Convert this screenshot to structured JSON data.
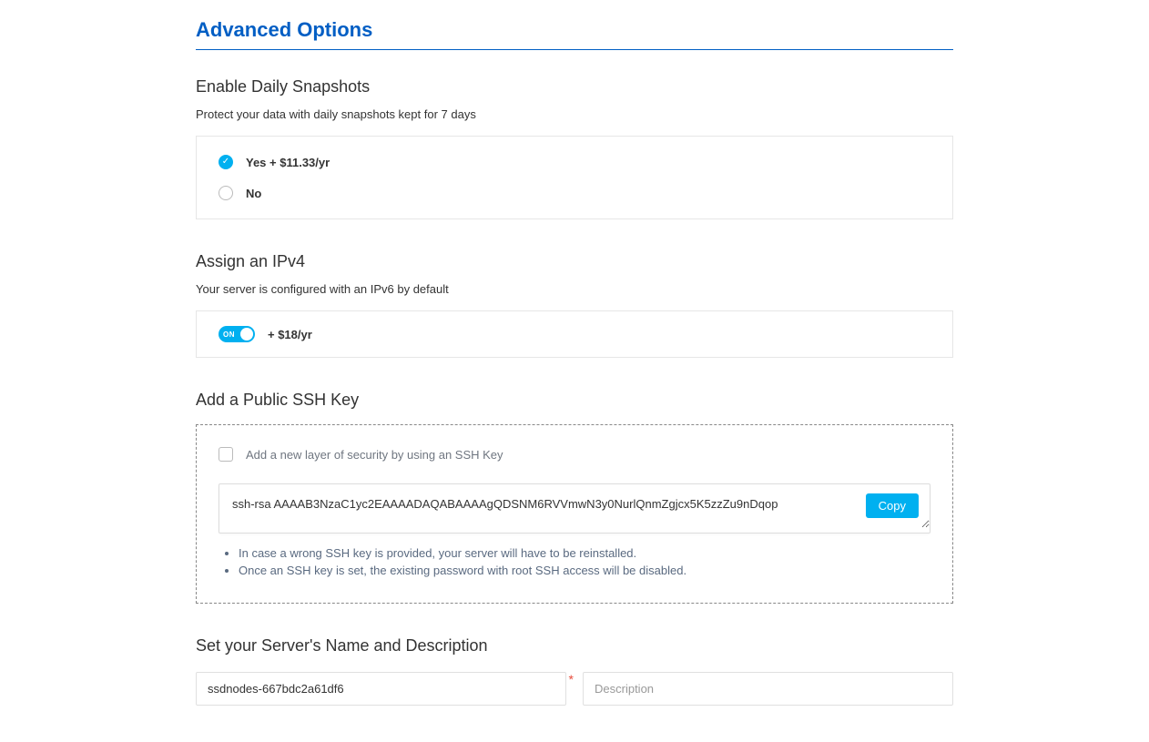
{
  "page_title": "Advanced Options",
  "snapshots": {
    "title": "Enable Daily Snapshots",
    "subtitle": "Protect your data with daily snapshots kept for 7 days",
    "options": {
      "yes": "Yes + $11.33/yr",
      "no": "No"
    },
    "selected": "yes"
  },
  "ipv4": {
    "title": "Assign an IPv4",
    "subtitle": "Your server is configured with an IPv6 by default",
    "toggle_on_label": "ON",
    "price_label": "+ $18/yr"
  },
  "ssh": {
    "title": "Add a Public SSH Key",
    "checkbox_label": "Add a new layer of security by using an SSH Key",
    "key_value": "ssh-rsa AAAAB3NzaC1yc2EAAAADAQABAAAAgQDSNM6RVVmwN3y0NurlQnmZgjcx5K5zzZu9nDqop",
    "copy_button": "Copy",
    "notes": [
      "In case a wrong SSH key is provided, your server will have to be reinstalled.",
      "Once an SSH key is set, the existing password with root SSH access will be disabled."
    ]
  },
  "server": {
    "title": "Set your Server's Name and Description",
    "name_value": "ssdnodes-667bdc2a61df6",
    "description_placeholder": "Description"
  }
}
